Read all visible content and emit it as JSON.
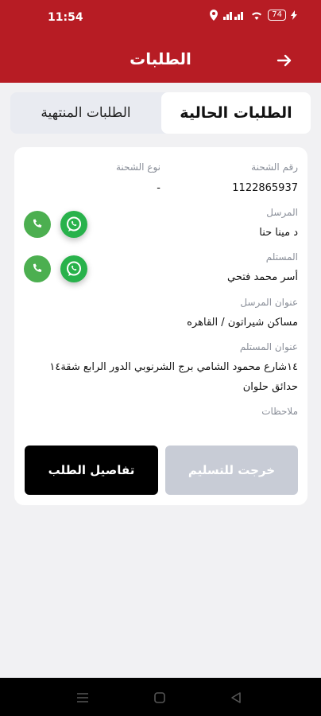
{
  "status": {
    "time": "11:54",
    "battery": "74"
  },
  "appbar": {
    "title": "الطلبات"
  },
  "tabs": {
    "current": "الطلبات الحالية",
    "finished": "الطلبات المنتهية"
  },
  "order": {
    "shipment_number_label": "رقم الشحنة",
    "shipment_number": "1122865937",
    "shipment_type_label": "نوع الشحنة",
    "shipment_type": "-",
    "sender_label": "المرسل",
    "sender": "د مينا حنا",
    "receiver_label": "المستلم",
    "receiver": "أسر محمد فتحي",
    "sender_address_label": "عنوان المرسل",
    "sender_address": "مساكن شيراتون / القاهره",
    "receiver_address_label": "عنوان المستلم",
    "receiver_address_line1": "١٤شارع محمود الشامي برج الشرنوبي الدور الرابع شقة١٤",
    "receiver_address_line2": "حدائق حلوان",
    "notes_label": "ملاحظات"
  },
  "buttons": {
    "out_for_delivery": "خرجت للتسليم",
    "order_details": "تفاصيل الطلب"
  }
}
